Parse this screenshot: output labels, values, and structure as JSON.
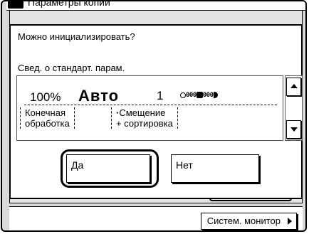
{
  "background_window": {
    "title": "Параметры копий",
    "system_monitor_label": "Систем. монитор"
  },
  "dialog": {
    "question": "Можно инициализировать?",
    "subtitle": "Свед. о стандарт. парам.",
    "settings": {
      "ratio": "100%",
      "paper": "Авто",
      "copies": "1",
      "finishing_line1": "Конечная",
      "finishing_line2": "обработка",
      "offset_line1": "Смещение",
      "offset_line2": "+ сортировка"
    },
    "yes_label": "Да",
    "no_label": "Нет"
  }
}
